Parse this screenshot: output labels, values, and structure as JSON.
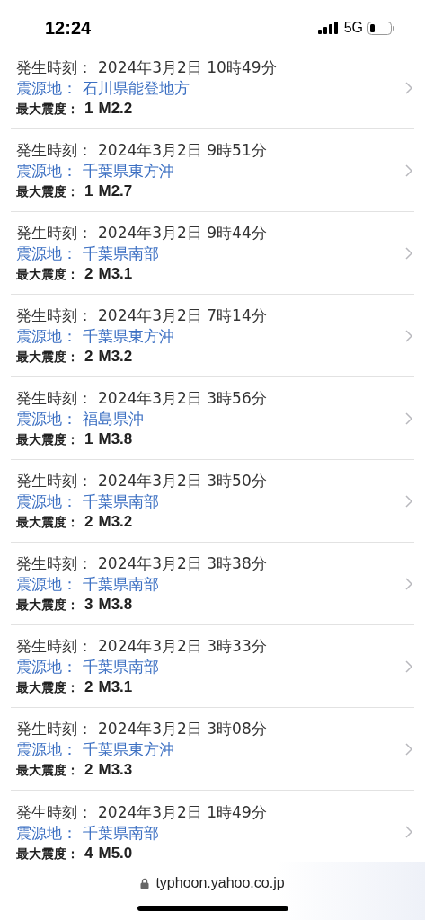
{
  "status_bar": {
    "time": "12:24",
    "network": "5G"
  },
  "quakes": [
    {
      "time_label": "発生時刻：",
      "time": "2024年3月2日 10時49分",
      "place_label": "震源地：",
      "place": "石川県能登地方",
      "intensity_label": "最大震度：",
      "intensity": "1",
      "magnitude": "M2.2"
    },
    {
      "time_label": "発生時刻：",
      "time": "2024年3月2日 9時51分",
      "place_label": "震源地：",
      "place": "千葉県東方沖",
      "intensity_label": "最大震度：",
      "intensity": "1",
      "magnitude": "M2.7"
    },
    {
      "time_label": "発生時刻：",
      "time": "2024年3月2日 9時44分",
      "place_label": "震源地：",
      "place": "千葉県南部",
      "intensity_label": "最大震度：",
      "intensity": "2",
      "magnitude": "M3.1"
    },
    {
      "time_label": "発生時刻：",
      "time": "2024年3月2日 7時14分",
      "place_label": "震源地：",
      "place": "千葉県東方沖",
      "intensity_label": "最大震度：",
      "intensity": "2",
      "magnitude": "M3.2"
    },
    {
      "time_label": "発生時刻：",
      "time": "2024年3月2日 3時56分",
      "place_label": "震源地：",
      "place": "福島県沖",
      "intensity_label": "最大震度：",
      "intensity": "1",
      "magnitude": "M3.8"
    },
    {
      "time_label": "発生時刻：",
      "time": "2024年3月2日 3時50分",
      "place_label": "震源地：",
      "place": "千葉県南部",
      "intensity_label": "最大震度：",
      "intensity": "2",
      "magnitude": "M3.2"
    },
    {
      "time_label": "発生時刻：",
      "time": "2024年3月2日 3時38分",
      "place_label": "震源地：",
      "place": "千葉県南部",
      "intensity_label": "最大震度：",
      "intensity": "3",
      "magnitude": "M3.8"
    },
    {
      "time_label": "発生時刻：",
      "time": "2024年3月2日 3時33分",
      "place_label": "震源地：",
      "place": "千葉県南部",
      "intensity_label": "最大震度：",
      "intensity": "2",
      "magnitude": "M3.1"
    },
    {
      "time_label": "発生時刻：",
      "time": "2024年3月2日 3時08分",
      "place_label": "震源地：",
      "place": "千葉県東方沖",
      "intensity_label": "最大震度：",
      "intensity": "2",
      "magnitude": "M3.3"
    },
    {
      "time_label": "発生時刻：",
      "time": "2024年3月2日 1時49分",
      "place_label": "震源地：",
      "place": "千葉県南部",
      "intensity_label": "最大震度：",
      "intensity": "4",
      "magnitude": "M5.0"
    }
  ],
  "address_bar": {
    "url": "typhoon.yahoo.co.jp"
  }
}
